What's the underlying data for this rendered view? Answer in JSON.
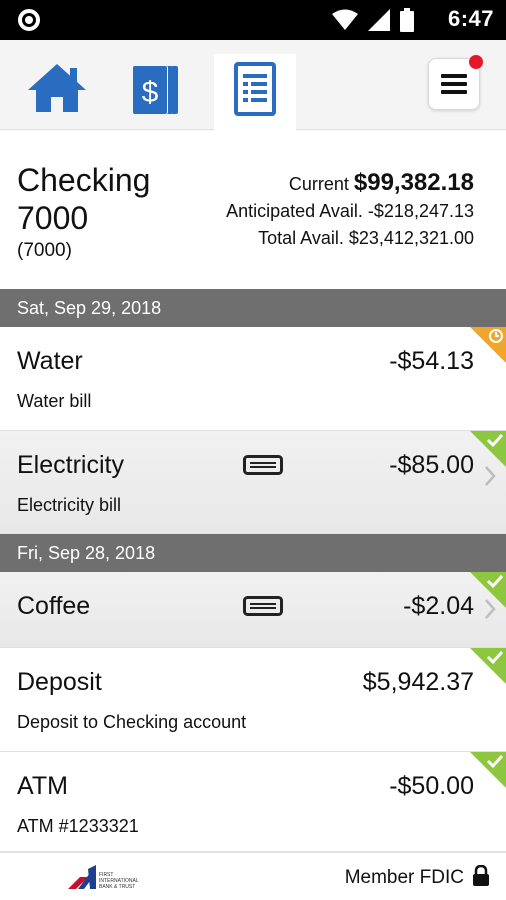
{
  "status_bar": {
    "time": "6:47"
  },
  "nav": {
    "tabs": [
      {
        "id": "home",
        "icon": "home-icon"
      },
      {
        "id": "accounts",
        "icon": "dollar-cards-icon"
      },
      {
        "id": "register",
        "icon": "document-list-icon",
        "active": true
      }
    ],
    "menu_icon": "hamburger-icon",
    "colors": {
      "accent": "#2a6cbf",
      "notification": "#e8162b"
    }
  },
  "account": {
    "name_line1": "Checking",
    "name_line2": "7000",
    "number": "(7000)",
    "current_label": "Current",
    "current_amount": "$99,382.18",
    "anticipated_label": "Anticipated Avail.",
    "anticipated_amount": "-$218,247.13",
    "total_label": "Total Avail.",
    "total_amount": "$23,412,321.00"
  },
  "groups": [
    {
      "date": "Sat, Sep 29, 2018",
      "transactions": [
        {
          "name": "Water",
          "amount": "-$54.13",
          "memo": "Water bill",
          "status": "pending"
        },
        {
          "name": "Electricity",
          "amount": "-$85.00",
          "memo": "Electricity bill",
          "status": "cleared",
          "card": true
        }
      ]
    },
    {
      "date": "Fri, Sep 28, 2018",
      "transactions": [
        {
          "name": "Coffee",
          "amount": "-$2.04",
          "memo": "",
          "status": "cleared",
          "card": true
        },
        {
          "name": "Deposit",
          "amount": "$5,942.37",
          "memo": "Deposit to Checking account",
          "status": "cleared"
        },
        {
          "name": "ATM",
          "amount": "-$50.00",
          "memo": "ATM #1233321",
          "status": "cleared"
        }
      ]
    }
  ],
  "footer": {
    "logo_text": "FIRST INTERNATIONAL BANK & TRUST",
    "member_text": "Member FDIC",
    "lock_icon": "lock-icon"
  },
  "status_colors": {
    "cleared": "#8dc63f",
    "pending": "#f0a52c"
  }
}
